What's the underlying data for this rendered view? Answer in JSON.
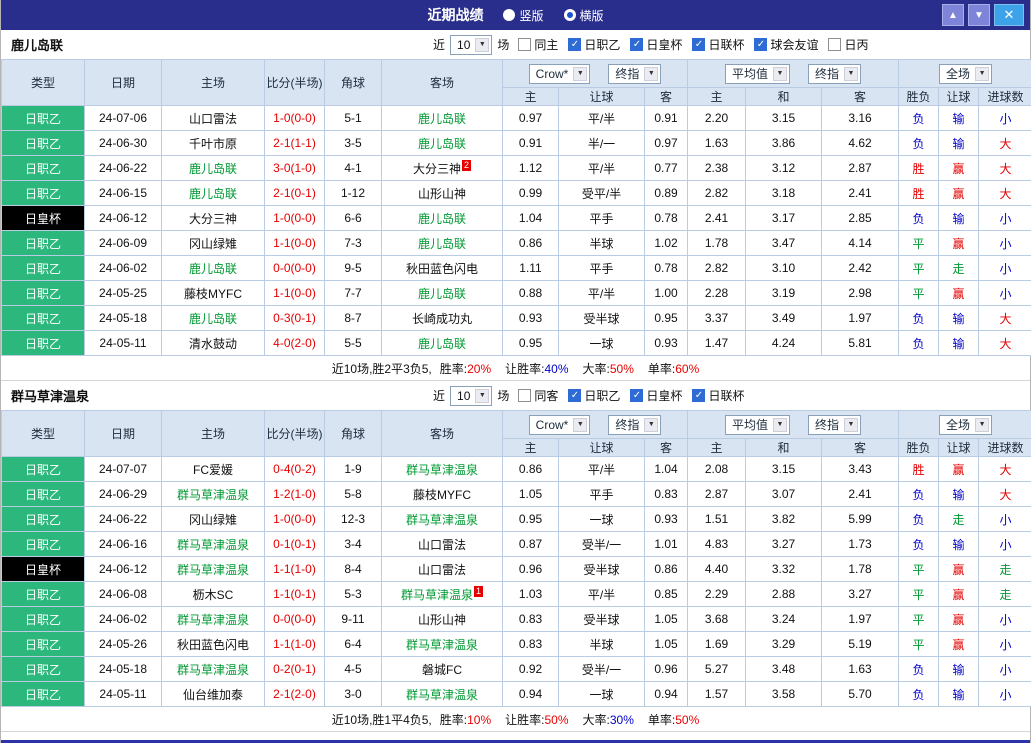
{
  "titlebar": {
    "title": "近期战绩",
    "layout_radios": [
      {
        "label": "竖版",
        "selected": false
      },
      {
        "label": "横版",
        "selected": true
      }
    ]
  },
  "icons": {
    "up": "▲",
    "down": "▼",
    "close": "✕",
    "select_arrow": "▼",
    "check": "✓"
  },
  "colors": {
    "titlebar_bg": "#292e8c",
    "league_green": "#2cb87d",
    "cup_black": "#000000",
    "team_green": "#009933",
    "win_red": "#e60000",
    "loss_blue": "#0000cc",
    "header_bg": "#d9e4f3"
  },
  "table": {
    "columns": {
      "type": "类型",
      "date": "日期",
      "home": "主场",
      "score": "比分(半场)",
      "corner": "角球",
      "away": "客场",
      "sub": [
        "主",
        "让球",
        "客",
        "主",
        "和",
        "客",
        "胜负",
        "让球",
        "进球数"
      ]
    },
    "group_headers": {
      "handicap_selects": [
        "Crow*",
        "终指"
      ],
      "odds_selects": [
        "平均值",
        "终指"
      ],
      "result_select": "全场"
    }
  },
  "sections": [
    {
      "team": "鹿儿岛联",
      "filter": {
        "near_label": "近",
        "rounds": "10",
        "games_label": "场",
        "checkboxes": [
          {
            "label": "同主",
            "checked": false
          },
          {
            "label": "日职乙",
            "checked": true
          },
          {
            "label": "日皇杯",
            "checked": true
          },
          {
            "label": "日联杯",
            "checked": true
          },
          {
            "label": "球会友谊",
            "checked": true
          },
          {
            "label": "日丙",
            "checked": false
          }
        ]
      },
      "rows": [
        {
          "type": "日职乙",
          "date": "24-07-06",
          "home": {
            "name": "山口雷法"
          },
          "score": "1-0(0-0)",
          "corner": "5-1",
          "away": {
            "name": "鹿儿岛联",
            "highlight": true
          },
          "handicap": [
            "0.97",
            "平/半",
            "0.91"
          ],
          "europe": [
            "2.20",
            "3.15",
            "3.16"
          ],
          "results": [
            "负",
            "输",
            "小"
          ]
        },
        {
          "type": "日职乙",
          "date": "24-06-30",
          "home": {
            "name": "千叶市原"
          },
          "score": "2-1(1-1)",
          "corner": "3-5",
          "away": {
            "name": "鹿儿岛联",
            "highlight": true
          },
          "handicap": [
            "0.91",
            "半/一",
            "0.97"
          ],
          "europe": [
            "1.63",
            "3.86",
            "4.62"
          ],
          "results": [
            "负",
            "输",
            "大"
          ]
        },
        {
          "type": "日职乙",
          "date": "24-06-22",
          "home": {
            "name": "鹿儿岛联",
            "highlight": true
          },
          "score": "3-0(1-0)",
          "corner": "4-1",
          "away": {
            "name": "大分三神",
            "badge": "2"
          },
          "handicap": [
            "1.12",
            "平/半",
            "0.77"
          ],
          "europe": [
            "2.38",
            "3.12",
            "2.87"
          ],
          "results": [
            "胜",
            "赢",
            "大"
          ]
        },
        {
          "type": "日职乙",
          "date": "24-06-15",
          "home": {
            "name": "鹿儿岛联",
            "highlight": true
          },
          "score": "2-1(0-1)",
          "corner": "1-12",
          "away": {
            "name": "山形山神"
          },
          "handicap": [
            "0.99",
            "受平/半",
            "0.89"
          ],
          "europe": [
            "2.82",
            "3.18",
            "2.41"
          ],
          "results": [
            "胜",
            "赢",
            "大"
          ]
        },
        {
          "type": "日皇杯",
          "date": "24-06-12",
          "home": {
            "name": "大分三神"
          },
          "score": "1-0(0-0)",
          "corner": "6-6",
          "away": {
            "name": "鹿儿岛联",
            "highlight": true
          },
          "handicap": [
            "1.04",
            "平手",
            "0.78"
          ],
          "europe": [
            "2.41",
            "3.17",
            "2.85"
          ],
          "results": [
            "负",
            "输",
            "小"
          ]
        },
        {
          "type": "日职乙",
          "date": "24-06-09",
          "home": {
            "name": "冈山绿雉"
          },
          "score": "1-1(0-0)",
          "corner": "7-3",
          "away": {
            "name": "鹿儿岛联",
            "highlight": true
          },
          "handicap": [
            "0.86",
            "半球",
            "1.02"
          ],
          "europe": [
            "1.78",
            "3.47",
            "4.14"
          ],
          "results": [
            "平",
            "赢",
            "小"
          ]
        },
        {
          "type": "日职乙",
          "date": "24-06-02",
          "home": {
            "name": "鹿儿岛联",
            "highlight": true
          },
          "score": "0-0(0-0)",
          "corner": "9-5",
          "away": {
            "name": "秋田蓝色闪电"
          },
          "handicap": [
            "1.11",
            "平手",
            "0.78"
          ],
          "europe": [
            "2.82",
            "3.10",
            "2.42"
          ],
          "results": [
            "平",
            "走",
            "小"
          ]
        },
        {
          "type": "日职乙",
          "date": "24-05-25",
          "home": {
            "name": "藤枝MYFC"
          },
          "score": "1-1(0-0)",
          "corner": "7-7",
          "away": {
            "name": "鹿儿岛联",
            "highlight": true
          },
          "handicap": [
            "0.88",
            "平/半",
            "1.00"
          ],
          "europe": [
            "2.28",
            "3.19",
            "2.98"
          ],
          "results": [
            "平",
            "赢",
            "小"
          ]
        },
        {
          "type": "日职乙",
          "date": "24-05-18",
          "home": {
            "name": "鹿儿岛联",
            "highlight": true
          },
          "score": "0-3(0-1)",
          "corner": "8-7",
          "away": {
            "name": "长崎成功丸"
          },
          "handicap": [
            "0.93",
            "受半球",
            "0.95"
          ],
          "europe": [
            "3.37",
            "3.49",
            "1.97"
          ],
          "results": [
            "负",
            "输",
            "大"
          ]
        },
        {
          "type": "日职乙",
          "date": "24-05-11",
          "home": {
            "name": "清水鼓动"
          },
          "score": "4-0(2-0)",
          "corner": "5-5",
          "away": {
            "name": "鹿儿岛联",
            "highlight": true
          },
          "handicap": [
            "0.95",
            "一球",
            "0.93"
          ],
          "europe": [
            "1.47",
            "4.24",
            "5.81"
          ],
          "results": [
            "负",
            "输",
            "大"
          ]
        }
      ],
      "footer": {
        "summary": "近10场,胜2平3负5,",
        "stats": [
          {
            "label": "胜率:",
            "value": "20%",
            "color": "red"
          },
          {
            "label": "让胜率:",
            "value": "40%",
            "color": "blue"
          },
          {
            "label": "大率:",
            "value": "50%",
            "color": "red"
          },
          {
            "label": "单率:",
            "value": "60%",
            "color": "red"
          }
        ]
      }
    },
    {
      "team": "群马草津温泉",
      "filter": {
        "near_label": "近",
        "rounds": "10",
        "games_label": "场",
        "checkboxes": [
          {
            "label": "同客",
            "checked": false
          },
          {
            "label": "日职乙",
            "checked": true
          },
          {
            "label": "日皇杯",
            "checked": true
          },
          {
            "label": "日联杯",
            "checked": true
          }
        ]
      },
      "rows": [
        {
          "type": "日职乙",
          "date": "24-07-07",
          "home": {
            "name": "FC爱媛"
          },
          "score": "0-4(0-2)",
          "corner": "1-9",
          "away": {
            "name": "群马草津温泉",
            "highlight": true
          },
          "handicap": [
            "0.86",
            "平/半",
            "1.04"
          ],
          "europe": [
            "2.08",
            "3.15",
            "3.43"
          ],
          "results": [
            "胜",
            "赢",
            "大"
          ]
        },
        {
          "type": "日职乙",
          "date": "24-06-29",
          "home": {
            "name": "群马草津温泉",
            "highlight": true
          },
          "score": "1-2(1-0)",
          "corner": "5-8",
          "away": {
            "name": "藤枝MYFC"
          },
          "handicap": [
            "1.05",
            "平手",
            "0.83"
          ],
          "europe": [
            "2.87",
            "3.07",
            "2.41"
          ],
          "results": [
            "负",
            "输",
            "大"
          ]
        },
        {
          "type": "日职乙",
          "date": "24-06-22",
          "home": {
            "name": "冈山绿雉"
          },
          "score": "1-0(0-0)",
          "corner": "12-3",
          "away": {
            "name": "群马草津温泉",
            "highlight": true
          },
          "handicap": [
            "0.95",
            "一球",
            "0.93"
          ],
          "europe": [
            "1.51",
            "3.82",
            "5.99"
          ],
          "results": [
            "负",
            "走",
            "小"
          ]
        },
        {
          "type": "日职乙",
          "date": "24-06-16",
          "home": {
            "name": "群马草津温泉",
            "highlight": true
          },
          "score": "0-1(0-1)",
          "corner": "3-4",
          "away": {
            "name": "山口雷法"
          },
          "handicap": [
            "0.87",
            "受半/一",
            "1.01"
          ],
          "europe": [
            "4.83",
            "3.27",
            "1.73"
          ],
          "results": [
            "负",
            "输",
            "小"
          ]
        },
        {
          "type": "日皇杯",
          "date": "24-06-12",
          "home": {
            "name": "群马草津温泉",
            "highlight": true
          },
          "score": "1-1(1-0)",
          "corner": "8-4",
          "away": {
            "name": "山口雷法"
          },
          "handicap": [
            "0.96",
            "受半球",
            "0.86"
          ],
          "europe": [
            "4.40",
            "3.32",
            "1.78"
          ],
          "results": [
            "平",
            "赢",
            "走"
          ]
        },
        {
          "type": "日职乙",
          "date": "24-06-08",
          "home": {
            "name": "枥木SC"
          },
          "score": "1-1(0-1)",
          "corner": "5-3",
          "away": {
            "name": "群马草津温泉",
            "highlight": true,
            "badge": "1"
          },
          "handicap": [
            "1.03",
            "平/半",
            "0.85"
          ],
          "europe": [
            "2.29",
            "2.88",
            "3.27"
          ],
          "results": [
            "平",
            "赢",
            "走"
          ]
        },
        {
          "type": "日职乙",
          "date": "24-06-02",
          "home": {
            "name": "群马草津温泉",
            "highlight": true
          },
          "score": "0-0(0-0)",
          "corner": "9-11",
          "away": {
            "name": "山形山神"
          },
          "handicap": [
            "0.83",
            "受半球",
            "1.05"
          ],
          "europe": [
            "3.68",
            "3.24",
            "1.97"
          ],
          "results": [
            "平",
            "赢",
            "小"
          ]
        },
        {
          "type": "日职乙",
          "date": "24-05-26",
          "home": {
            "name": "秋田蓝色闪电"
          },
          "score": "1-1(1-0)",
          "corner": "6-4",
          "away": {
            "name": "群马草津温泉",
            "highlight": true
          },
          "handicap": [
            "0.83",
            "半球",
            "1.05"
          ],
          "europe": [
            "1.69",
            "3.29",
            "5.19"
          ],
          "results": [
            "平",
            "赢",
            "小"
          ]
        },
        {
          "type": "日职乙",
          "date": "24-05-18",
          "home": {
            "name": "群马草津温泉",
            "highlight": true
          },
          "score": "0-2(0-1)",
          "corner": "4-5",
          "away": {
            "name": "磐城FC"
          },
          "handicap": [
            "0.92",
            "受半/一",
            "0.96"
          ],
          "europe": [
            "5.27",
            "3.48",
            "1.63"
          ],
          "results": [
            "负",
            "输",
            "小"
          ]
        },
        {
          "type": "日职乙",
          "date": "24-05-11",
          "home": {
            "name": "仙台维加泰"
          },
          "score": "2-1(2-0)",
          "corner": "3-0",
          "away": {
            "name": "群马草津温泉",
            "highlight": true
          },
          "handicap": [
            "0.94",
            "一球",
            "0.94"
          ],
          "europe": [
            "1.57",
            "3.58",
            "5.70"
          ],
          "results": [
            "负",
            "输",
            "小"
          ]
        }
      ],
      "footer": {
        "summary": "近10场,胜1平4负5,",
        "stats": [
          {
            "label": "胜率:",
            "value": "10%",
            "color": "red"
          },
          {
            "label": "让胜率:",
            "value": "50%",
            "color": "red"
          },
          {
            "label": "大率:",
            "value": "30%",
            "color": "blue"
          },
          {
            "label": "单率:",
            "value": "50%",
            "color": "red"
          }
        ]
      }
    }
  ]
}
